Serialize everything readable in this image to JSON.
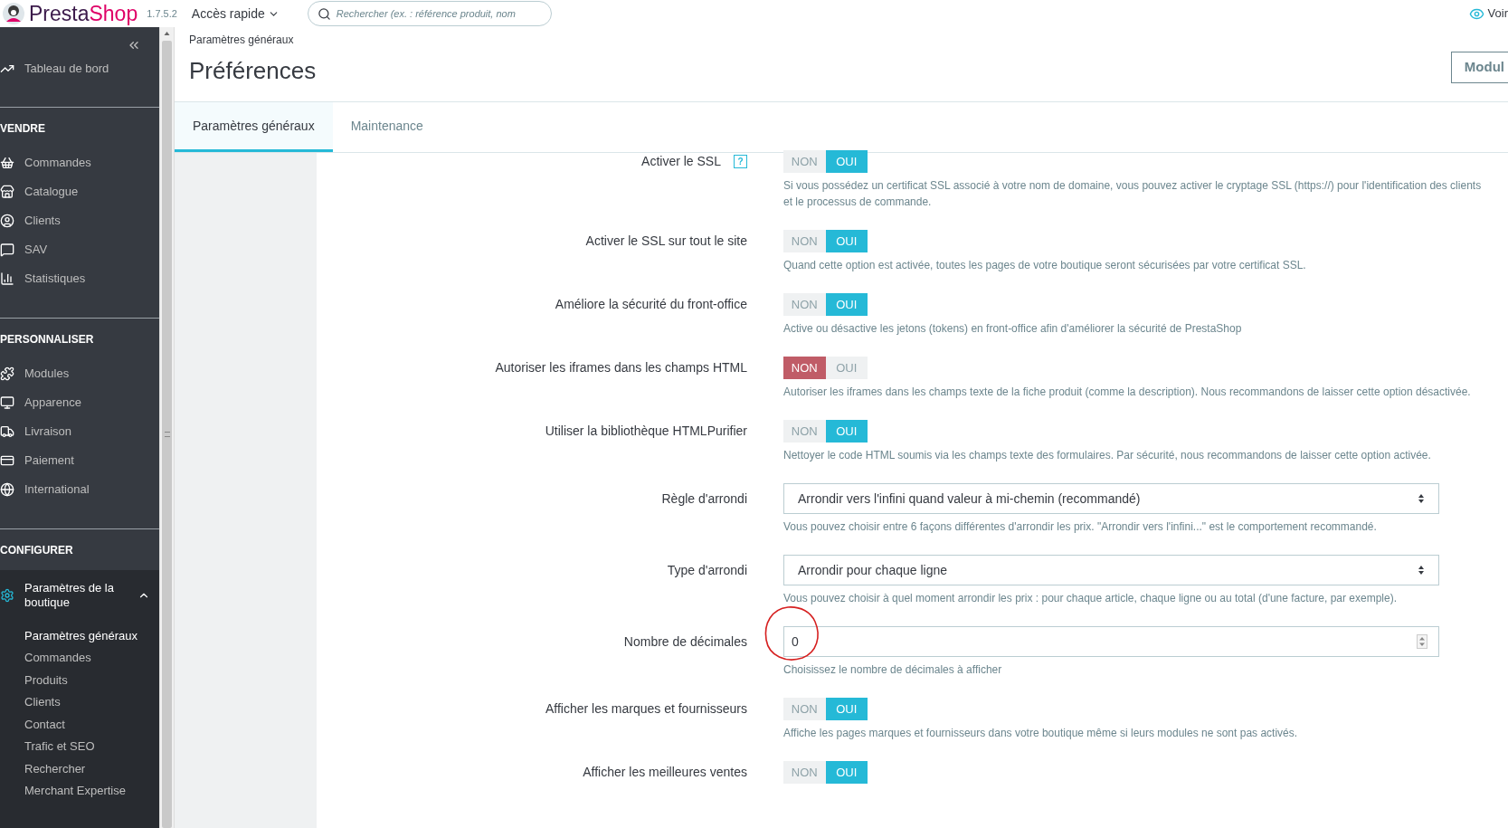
{
  "top_bar": {
    "logo_parts": [
      "Presta",
      "Shop"
    ],
    "version": "1.7.5.2",
    "quick_access": "Accès rapide",
    "search": {
      "placeholder": "Rechercher (ex. : référence produit, nom"
    },
    "view_shop": "Voir"
  },
  "sidebar": {
    "sections": [
      {
        "items": [
          {
            "label": "Tableau de bord"
          }
        ]
      },
      {
        "title": "VENDRE",
        "items": [
          {
            "label": "Commandes"
          },
          {
            "label": "Catalogue"
          },
          {
            "label": "Clients"
          },
          {
            "label": "SAV"
          },
          {
            "label": "Statistiques"
          }
        ]
      },
      {
        "title": "PERSONNALISER",
        "items": [
          {
            "label": "Modules"
          },
          {
            "label": "Apparence"
          },
          {
            "label": "Livraison"
          },
          {
            "label": "Paiement"
          },
          {
            "label": "International"
          }
        ]
      },
      {
        "title": "CONFIGURER",
        "items": [
          {
            "label": "Paramètres de la boutique",
            "expanded": true,
            "children": [
              {
                "label": "Paramètres généraux",
                "selected": true
              },
              {
                "label": "Commandes",
                "selected": false
              },
              {
                "label": "Produits",
                "selected": false
              },
              {
                "label": "Clients",
                "selected": false
              },
              {
                "label": "Contact",
                "selected": false
              },
              {
                "label": "Trafic et SEO",
                "selected": false
              },
              {
                "label": "Rechercher",
                "selected": false
              },
              {
                "label": "Merchant Expertise",
                "selected": false
              }
            ]
          }
        ]
      }
    ]
  },
  "header": {
    "breadcrumb": "Paramètres généraux",
    "title": "Préférences",
    "button": "Modul"
  },
  "tabs": [
    {
      "label": "Paramètres généraux",
      "selected": true
    },
    {
      "label": "Maintenance",
      "selected": false
    }
  ],
  "form": [
    {
      "kind": "switch",
      "label": "Activer le SSL",
      "help_icon": "?",
      "off": "NON",
      "on_label": "OUI",
      "on": true,
      "help": "Si vous possédez un certificat SSL associé à votre nom de domaine, vous pouvez activer le cryptage SSL (https://) pour l'identification des clients et le processus de commande."
    },
    {
      "kind": "switch",
      "label": "Activer le SSL sur tout le site",
      "off": "NON",
      "on_label": "OUI",
      "on": true,
      "help": "Quand cette option est activée, toutes les pages de votre boutique seront sécurisées par votre certificat SSL."
    },
    {
      "kind": "switch",
      "label": "Améliore la sécurité du front-office",
      "off": "NON",
      "on_label": "OUI",
      "on": true,
      "help": "Active ou désactive les jetons (tokens) en front-office afin d'améliorer la sécurité de PrestaShop"
    },
    {
      "kind": "switch",
      "label": "Autoriser les iframes dans les champs HTML",
      "off": "NON",
      "on_label": "OUI",
      "on": false,
      "help": "Autoriser les iframes dans les champs texte de la fiche produit (comme la description). Nous recommandons de laisser cette option désactivée."
    },
    {
      "kind": "switch",
      "label": "Utiliser la bibliothèque HTMLPurifier",
      "off": "NON",
      "on_label": "OUI",
      "on": true,
      "help": "Nettoyer le code HTML soumis via les champs texte des formulaires. Par sécurité, nous recommandons de laisser cette option activée."
    },
    {
      "kind": "select",
      "label": "Règle d'arrondi",
      "value": "Arrondir vers l'infini quand valeur à mi-chemin (recommandé)",
      "help": "Vous pouvez choisir entre 6 façons différentes d'arrondir les prix. \"Arrondir vers l'infini...\" est le comportement recommandé."
    },
    {
      "kind": "select",
      "label": "Type d'arrondi",
      "value": "Arrondir pour chaque ligne",
      "help": "Vous pouvez choisir à quel moment arrondir les prix : pour chaque article, chaque ligne ou au total (d'une facture, par exemple)."
    },
    {
      "kind": "number",
      "label": "Nombre de décimales",
      "value": "0",
      "circled": true,
      "help": "Choisissez le nombre de décimales à afficher"
    },
    {
      "kind": "switch",
      "label": "Afficher les marques et fournisseurs",
      "off": "NON",
      "on_label": "OUI",
      "on": true,
      "help": "Affiche les pages marques et fournisseurs dans votre boutique même si leurs modules ne sont pas activés."
    },
    {
      "kind": "switch",
      "label": "Afficher les meilleures ventes",
      "off": "NON",
      "on_label": "OUI",
      "on": true
    }
  ]
}
